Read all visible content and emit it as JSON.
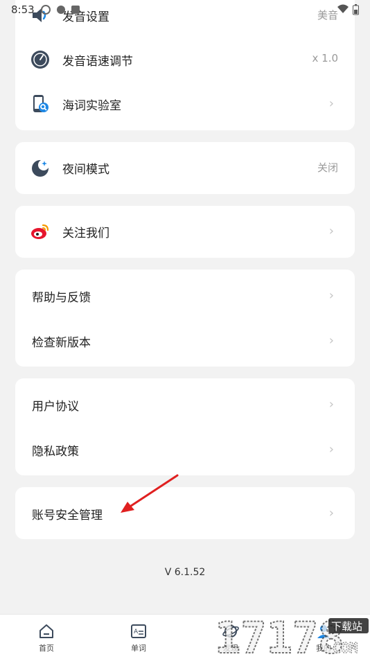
{
  "status_bar": {
    "time": "8:53"
  },
  "settings": {
    "pronunciation": {
      "label": "发音设置",
      "value": "美音"
    },
    "speed": {
      "label": "发音语速调节",
      "value": "x 1.0"
    },
    "lab": {
      "label": "海词实验室"
    },
    "night": {
      "label": "夜间模式",
      "value": "关闭"
    },
    "follow": {
      "label": "关注我们"
    },
    "help": {
      "label": "帮助与反馈"
    },
    "update": {
      "label": "检查新版本"
    },
    "agreement": {
      "label": "用户协议"
    },
    "privacy": {
      "label": "隐私政策"
    },
    "account": {
      "label": "账号安全管理"
    }
  },
  "version": "V 6.1.52",
  "tabs": [
    {
      "label": "首页",
      "icon": "home-icon"
    },
    {
      "label": "单词",
      "icon": "word-card-icon"
    },
    {
      "label": "发现",
      "icon": "planet-icon"
    },
    {
      "label": "我的",
      "icon": "user-icon"
    }
  ],
  "watermark": {
    "text": "17178",
    "badge": "下载站",
    "domain": "COM"
  },
  "colors": {
    "accent": "#1e88e5",
    "arrow": "#e02020",
    "weibo": "#e6162d"
  }
}
